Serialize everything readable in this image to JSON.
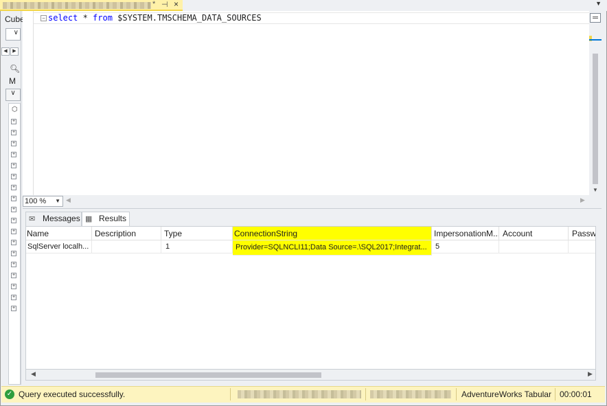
{
  "document_tab": {
    "modified_marker": "*",
    "pin_icon": "pin-icon",
    "close_icon": "close-icon"
  },
  "left_panel": {
    "cube_label": "Cube",
    "combo_value": "∣",
    "m_label": "M"
  },
  "editor": {
    "query_keyword_select": "select",
    "query_star": " * ",
    "query_keyword_from": "from",
    "query_rest": " $SYSTEM.TMSCHEMA_DATA_SOURCES"
  },
  "zoom": {
    "value": "100 %"
  },
  "results_tabs": [
    {
      "label": "Messages",
      "icon": "messages-icon"
    },
    {
      "label": "Results",
      "icon": "grid-icon"
    }
  ],
  "grid": {
    "columns": [
      "Name",
      "Description",
      "Type",
      "ConnectionString",
      "ImpersonationM...",
      "Account",
      "Passwo"
    ],
    "rows": [
      [
        "SqlServer localh...",
        "",
        "1",
        "Provider=SQLNCLI11;Data Source=.\\SQL2017;Integrat...",
        "5",
        "",
        ""
      ]
    ],
    "highlight_color": "#ffff00"
  },
  "status": {
    "message": "Query executed successfully.",
    "database": "AdventureWorks Tabular",
    "elapsed": "00:00:01",
    "bar_color": "#fdf4bf"
  }
}
